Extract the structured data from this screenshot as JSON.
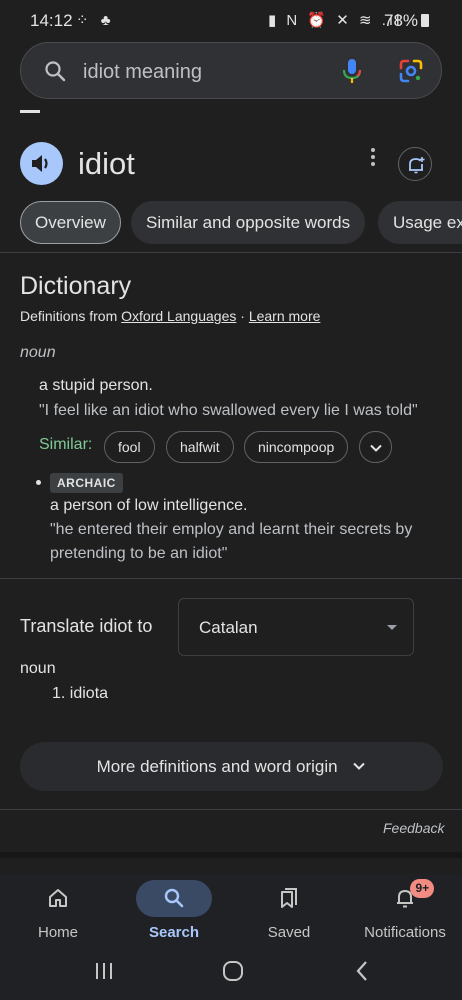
{
  "status_bar": {
    "time": "14:12",
    "left_icons": "⁘ ♣",
    "right_icons": "▮ N ⏰ ✕ ≋ .ıl",
    "battery": "78%"
  },
  "search": {
    "query": "idiot meaning",
    "icons": [
      "search-icon",
      "mic-icon",
      "lens-icon"
    ]
  },
  "word_header": {
    "word": "idiot",
    "icons": [
      "speaker-icon",
      "more-vert-icon",
      "add-alert-icon"
    ]
  },
  "tabs": [
    {
      "label": "Overview",
      "active": true
    },
    {
      "label": "Similar and opposite words",
      "active": false
    },
    {
      "label": "Usage ex",
      "active": false
    }
  ],
  "dictionary": {
    "title": "Dictionary",
    "source_prefix": "Definitions from ",
    "source_link": "Oxford Languages",
    "source_sep": " · ",
    "learn_more": "Learn more",
    "part_of_speech": "noun",
    "definition_1": "a stupid person.",
    "example_1": "\"I feel like an idiot who swallowed every lie I was told\"",
    "similar_label": "Similar:",
    "similar_words": [
      "fool",
      "halfwit",
      "nincompoop"
    ],
    "archaic_badge": "ARCHAIC",
    "definition_2": "a person of low intelligence.",
    "example_2_line1": "\"he entered their employ and learnt their secrets by",
    "example_2_line2": "pretending to be an idiot\""
  },
  "translate": {
    "label": "Translate idiot to",
    "language": "Catalan",
    "part_of_speech": "noun",
    "result": "1. idiota"
  },
  "more_definitions": {
    "label": "More definitions and word origin"
  },
  "feedback": "Feedback",
  "bottom_nav": [
    {
      "label": "Home",
      "icon": "home-icon",
      "active": false
    },
    {
      "label": "Search",
      "icon": "search-icon",
      "active": true
    },
    {
      "label": "Saved",
      "icon": "saved-icon",
      "active": false
    },
    {
      "label": "Notifications",
      "icon": "bell-icon",
      "active": false,
      "badge": "9+"
    }
  ],
  "colors": {
    "background": "#1f1f1f",
    "accent": "#a8c7fa",
    "similar_green": "#81c995",
    "badge": "#f28b82"
  }
}
